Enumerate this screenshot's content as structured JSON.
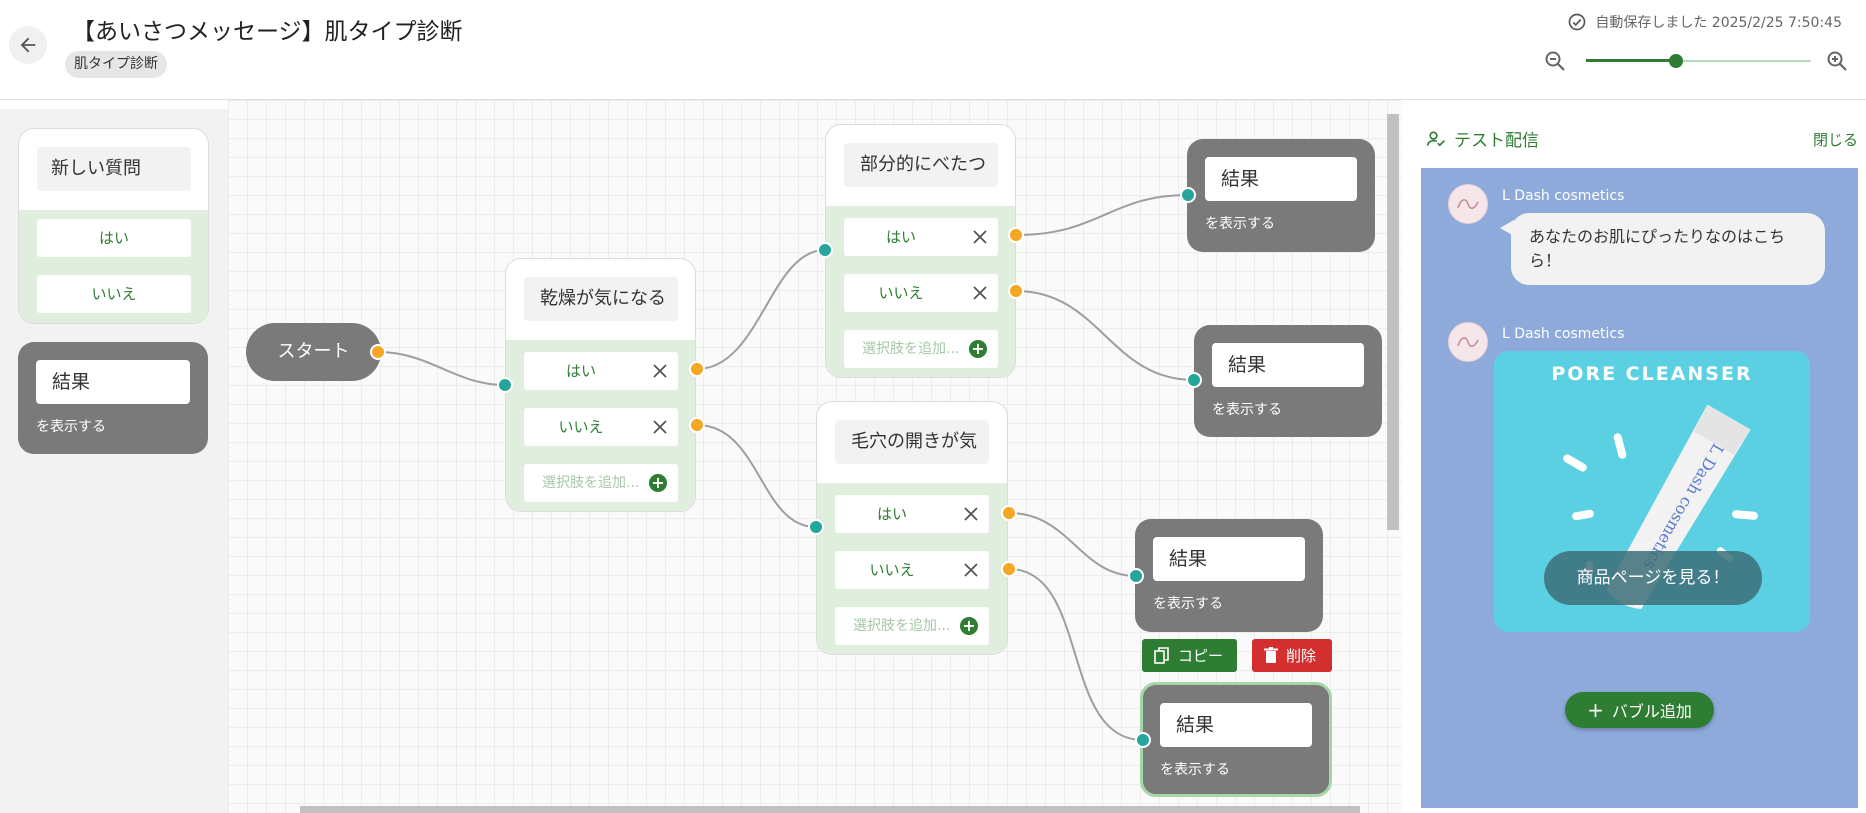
{
  "header": {
    "title": "【あいさつメッセージ】肌タイプ診断",
    "tag": "肌タイプ診断",
    "autosave": "自動保存しました 2025/2/25 7:50:45",
    "zoom_level": 0.4
  },
  "palette": {
    "question": {
      "title": "新しい質問",
      "options": [
        "はい",
        "いいえ"
      ]
    },
    "result": {
      "title": "結果",
      "subtitle": "を表示する"
    }
  },
  "canvas": {
    "start_label": "スタート",
    "questions": [
      {
        "title": "乾燥が気になる",
        "options": [
          "はい",
          "いいえ"
        ],
        "add_option": "選択肢を追加..."
      },
      {
        "title": "部分的にべたつ",
        "options": [
          "はい",
          "いいえ"
        ],
        "add_option": "選択肢を追加..."
      },
      {
        "title": "毛穴の開きが気",
        "options": [
          "はい",
          "いいえ"
        ],
        "add_option": "選択肢を追加..."
      }
    ],
    "results": [
      {
        "title": "結果",
        "subtitle": "を表示する"
      },
      {
        "title": "結果",
        "subtitle": "を表示する"
      },
      {
        "title": "結果",
        "subtitle": "を表示する"
      },
      {
        "title": "結果",
        "subtitle": "を表示する"
      }
    ],
    "actions": {
      "copy": "コピー",
      "delete": "削除"
    }
  },
  "test_panel": {
    "title": "テスト配信",
    "close": "閉じる",
    "messages": [
      {
        "sender": "L Dash cosmetics",
        "text": "あなたのお肌にぴったりなのはこちら！"
      },
      {
        "sender": "L Dash cosmetics",
        "card_title": "PORE CLEANSER",
        "product_text": "L Dash cosmetics",
        "button": "商品ページを見る！"
      }
    ],
    "add_bubble": "バブル追加"
  },
  "colors": {
    "accent_green": "#2e7d32",
    "node_gray": "#7a7a7a",
    "option_area": "#dfeedd",
    "connector_in": "#26a69a",
    "connector_out": "#f5a623",
    "delete_red": "#d32f2f",
    "chat_bg": "#8eaadb"
  },
  "icons": {
    "back": "arrow-left-icon",
    "autosave": "check-circle-icon",
    "zoom_out": "zoom-out-icon",
    "zoom_in": "zoom-in-icon",
    "remove_option": "close-icon",
    "add_option": "plus-circle-icon",
    "copy": "copy-icon",
    "delete": "trash-icon",
    "test": "person-check-icon",
    "add_bubble": "plus-icon"
  }
}
